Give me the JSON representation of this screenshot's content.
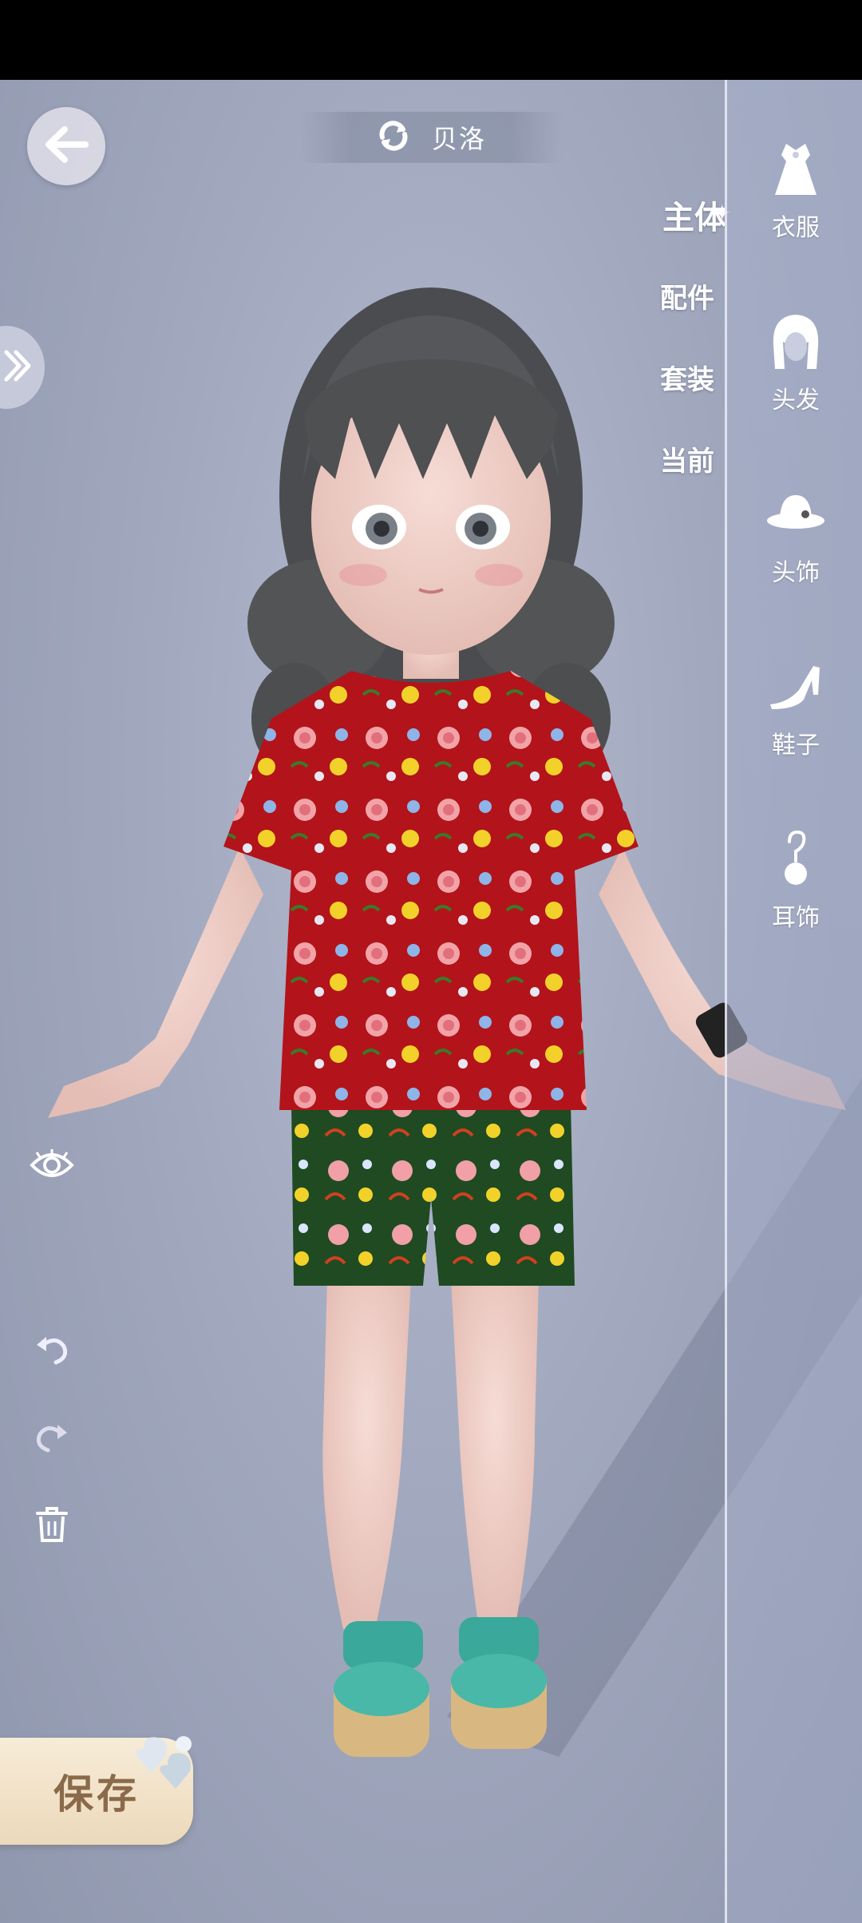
{
  "header": {
    "character_name": "贝洛"
  },
  "subtabs": [
    {
      "label": "主体",
      "active": true
    },
    {
      "label": "配件",
      "active": false
    },
    {
      "label": "套装",
      "active": false
    },
    {
      "label": "当前",
      "active": false
    }
  ],
  "categories": [
    {
      "label": "衣服",
      "icon": "dress-icon"
    },
    {
      "label": "头发",
      "icon": "hair-icon"
    },
    {
      "label": "头饰",
      "icon": "hat-icon"
    },
    {
      "label": "鞋子",
      "icon": "high-heel-icon"
    },
    {
      "label": "耳饰",
      "icon": "earring-icon"
    }
  ],
  "tools": {
    "visibility": "eye-icon",
    "undo": "undo-icon",
    "redo": "redo-icon",
    "delete": "trash-icon"
  },
  "save": {
    "label": "保存"
  },
  "colors": {
    "background": "#a2a9bf",
    "shirt": "#b3131a",
    "shorts": "#1f4a22",
    "hair": "#4e5052",
    "save_button": "#f3e6cf",
    "save_text": "#8a6a4a"
  }
}
